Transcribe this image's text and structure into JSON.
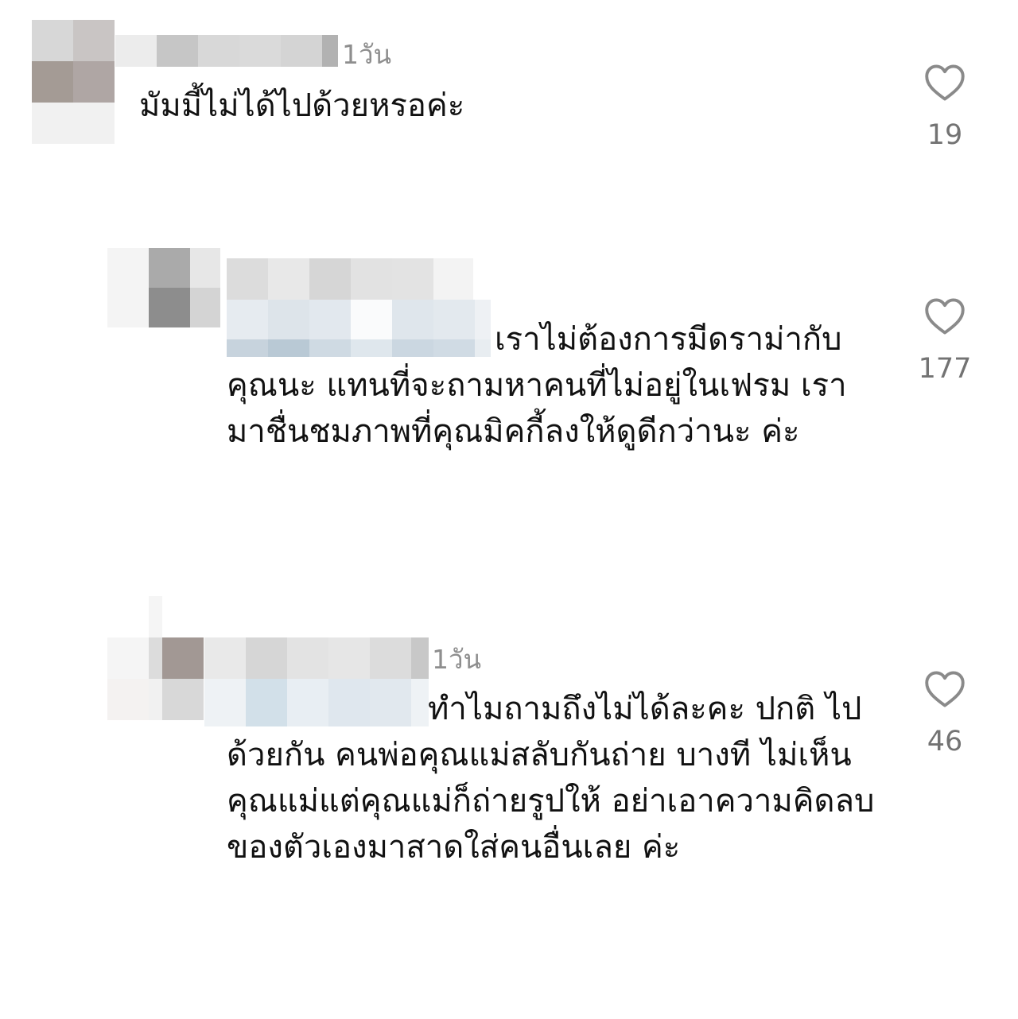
{
  "comments": [
    {
      "time": "1วัน",
      "text": "มัมมี้ไม่ได้ไปด้วยหรอค่ะ",
      "likes": "19",
      "like_icon": "heart-outline-icon"
    },
    {
      "time": "",
      "text": "เราไม่ต้องการมีดราม่ากับ คุณนะ  แทนที่จะถามหาคนที่ไม่อยู่ในเฟรม เรามาชื่นชมภาพที่คุณมิคกี้ลงให้ดูดีกว่านะ ค่ะ",
      "likes": "177",
      "like_icon": "heart-outline-icon"
    },
    {
      "time": "1วัน",
      "text": "ทำไมถามถึงไม่ได้ละคะ ปกติ ไปด้วยกัน คนพ่อคุณแม่สลับกันถ่าย บางที ไม่เห็นคุณแม่แต่คุณแม่ก็ถ่ายรูปให้ อย่าเอาความคิดลบของตัวเองมาสาดใส่คนอื่นเลย ค่ะ",
      "likes": "46",
      "like_icon": "heart-outline-icon"
    }
  ]
}
